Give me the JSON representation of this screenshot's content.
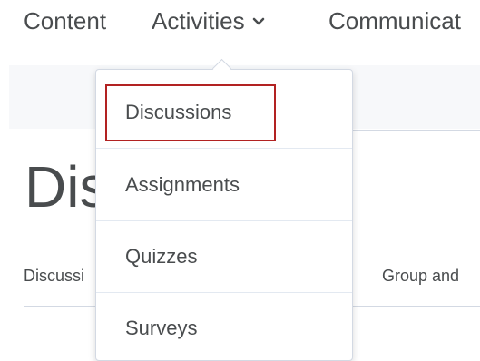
{
  "navbar": {
    "items": [
      {
        "label": "Content"
      },
      {
        "label": "Activities",
        "icon": "chevron-down-icon"
      },
      {
        "label": "Communicat"
      }
    ]
  },
  "page": {
    "title": "Dis",
    "subnav_left": "Discussi",
    "subnav_right": "Group and"
  },
  "dropdown": {
    "items": [
      {
        "label": "Discussions",
        "highlighted": true
      },
      {
        "label": "Assignments"
      },
      {
        "label": "Quizzes"
      },
      {
        "label": "Surveys"
      }
    ]
  },
  "colors": {
    "highlight_border": "#b22222",
    "text": "#494c4e"
  }
}
